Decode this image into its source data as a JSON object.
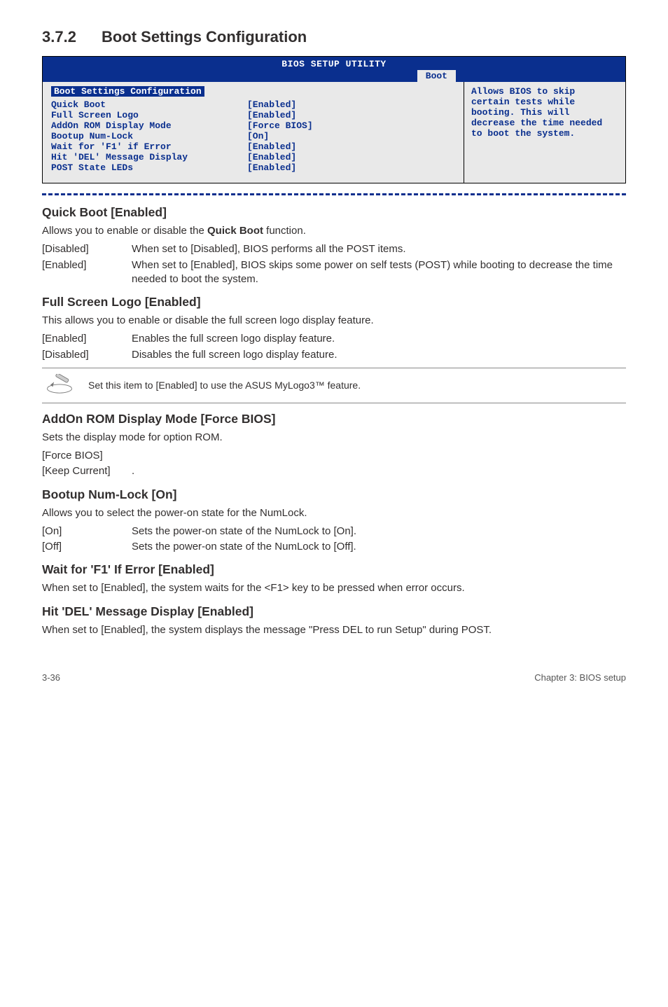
{
  "section": {
    "number": "3.7.2",
    "title": "Boot Settings Configuration"
  },
  "bios": {
    "header_title": "BIOS SETUP UTILITY",
    "tab": "Boot",
    "panel_title": "Boot Settings Configuration",
    "rows": [
      {
        "label": "Quick Boot",
        "value": "[Enabled]"
      },
      {
        "label": "Full Screen Logo",
        "value": "[Enabled]"
      },
      {
        "label": "AddOn ROM Display Mode",
        "value": "[Force BIOS]"
      },
      {
        "label": "Bootup Num-Lock",
        "value": "[On]"
      },
      {
        "label": "Wait for 'F1' if Error",
        "value": "[Enabled]"
      },
      {
        "label": "Hit 'DEL' Message Display",
        "value": "[Enabled]"
      },
      {
        "label": "POST State LEDs",
        "value": "[Enabled]"
      }
    ],
    "help": "Allows BIOS to skip certain tests while booting. This will decrease the time needed to boot the system."
  },
  "quickboot": {
    "heading": "Quick Boot [Enabled]",
    "desc_prefix": "Allows you to enable or disable the ",
    "desc_bold": "Quick Boot",
    "desc_suffix": " function.",
    "opts": [
      {
        "k": "[Disabled]",
        "v": "When set to [Disabled], BIOS performs all the POST items."
      },
      {
        "k": "[Enabled]",
        "v": "When set to [Enabled], BIOS skips some power on self tests (POST) while booting to decrease the time needed to boot the system."
      }
    ]
  },
  "fullscreen": {
    "heading": "Full Screen Logo [Enabled]",
    "desc": "This allows you to enable or disable the full screen logo display feature.",
    "opts": [
      {
        "k": "[Enabled]",
        "v": "Enables the full screen logo display feature."
      },
      {
        "k": "[Disabled]",
        "v": "Disables the full screen logo display feature."
      }
    ],
    "note": "Set this item to [Enabled] to use the ASUS MyLogo3™ feature."
  },
  "addon": {
    "heading": "AddOn ROM Display Mode [Force BIOS]",
    "desc": "Sets the display mode for option ROM.",
    "opts": [
      {
        "k": "[Force BIOS]",
        "v": ""
      },
      {
        "k": "[Keep Current]",
        "v": "."
      }
    ]
  },
  "numlock": {
    "heading": "Bootup Num-Lock [On]",
    "desc": "Allows you to select the power-on state for the NumLock.",
    "opts": [
      {
        "k": "[On]",
        "v": "Sets the power-on state of the NumLock to [On]."
      },
      {
        "k": "[Off]",
        "v": "Sets the power-on state of the NumLock to [Off]."
      }
    ]
  },
  "waitf1": {
    "heading": "Wait for 'F1' If Error [Enabled]",
    "desc": "When set to [Enabled], the system waits for the <F1> key to be pressed when error occurs."
  },
  "hitdel": {
    "heading": "Hit 'DEL' Message Display [Enabled]",
    "desc": "When set to [Enabled], the system displays the message \"Press DEL to run Setup\" during POST."
  },
  "footer": {
    "left": "3-36",
    "right": "Chapter 3: BIOS setup"
  }
}
